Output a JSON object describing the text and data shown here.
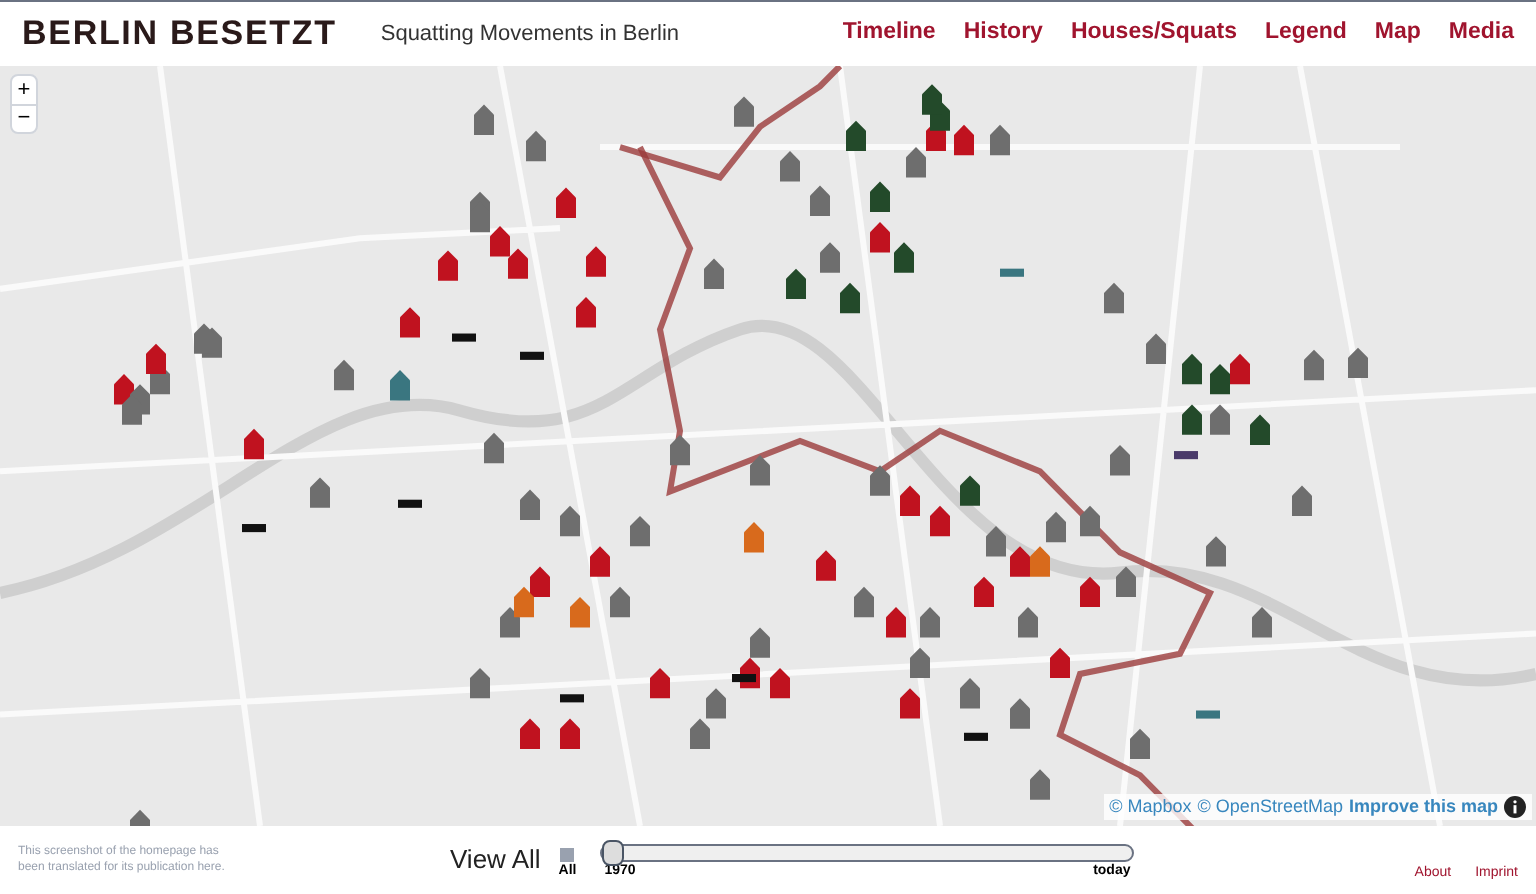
{
  "header": {
    "logo": "BERLIN BESETZT",
    "subtitle": "Squatting Movements in Berlin",
    "nav": [
      {
        "label": "Timeline"
      },
      {
        "label": "History"
      },
      {
        "label": "Houses/Squats"
      },
      {
        "label": "Legend"
      },
      {
        "label": "Map"
      },
      {
        "label": "Media"
      }
    ]
  },
  "map": {
    "zoom_in": "+",
    "zoom_out": "−",
    "attribution": {
      "mapbox": "© Mapbox",
      "osm": "© OpenStreetMap",
      "improve": "Improve this map"
    }
  },
  "footer": {
    "note": "This screenshot of the homepage has been translated for its publication here.",
    "view_all": "View All",
    "all_checkbox": {
      "label": "All",
      "checked": true
    },
    "timeline": {
      "level": 0,
      "start": "1970",
      "end": "today"
    },
    "links": [
      {
        "label": "About"
      },
      {
        "label": "Imprint"
      }
    ]
  }
}
